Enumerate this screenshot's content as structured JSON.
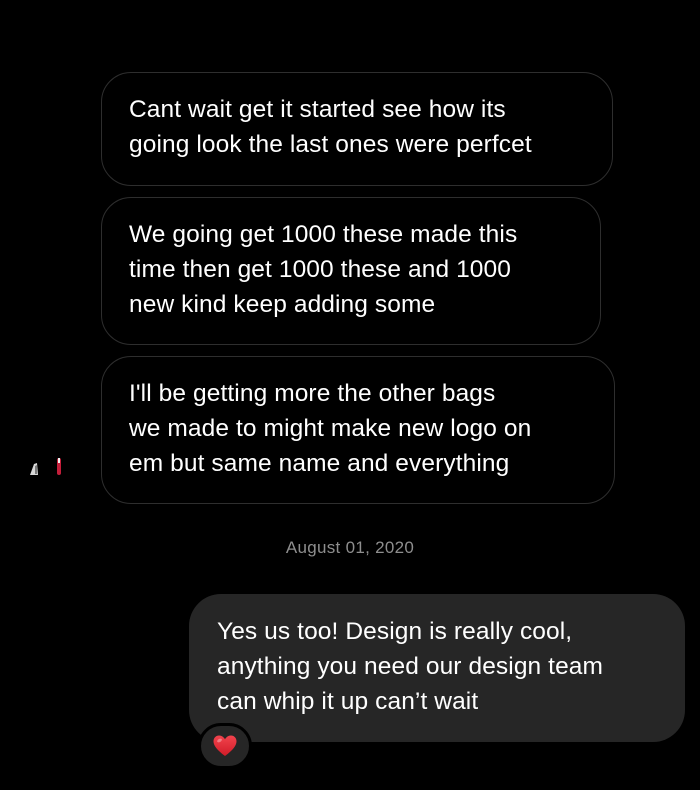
{
  "messages": [
    {
      "direction": "received",
      "text": "Cant wait get it started see how its\ngoing look the last ones were perfcet"
    },
    {
      "direction": "received",
      "text": "We going get 1000 these made this\ntime then get 1000 these and 1000\nnew kind keep adding some"
    },
    {
      "direction": "received",
      "text": "I'll be getting more the other bags\nwe made to might make new logo on\nem but same name and everything"
    },
    {
      "direction": "sent",
      "text": "Yes us too! Design is really cool,\nanything you need our design team\ncan whip it up can’t wait",
      "reaction": "heart-icon"
    }
  ],
  "date_separator": "August 01, 2020",
  "colors": {
    "background": "#000000",
    "received_border": "#2e2e2e",
    "sent_bubble": "#262626",
    "text": "#ffffff",
    "timestamp": "#8e8e8e",
    "reaction_heart": "#e0252f"
  }
}
